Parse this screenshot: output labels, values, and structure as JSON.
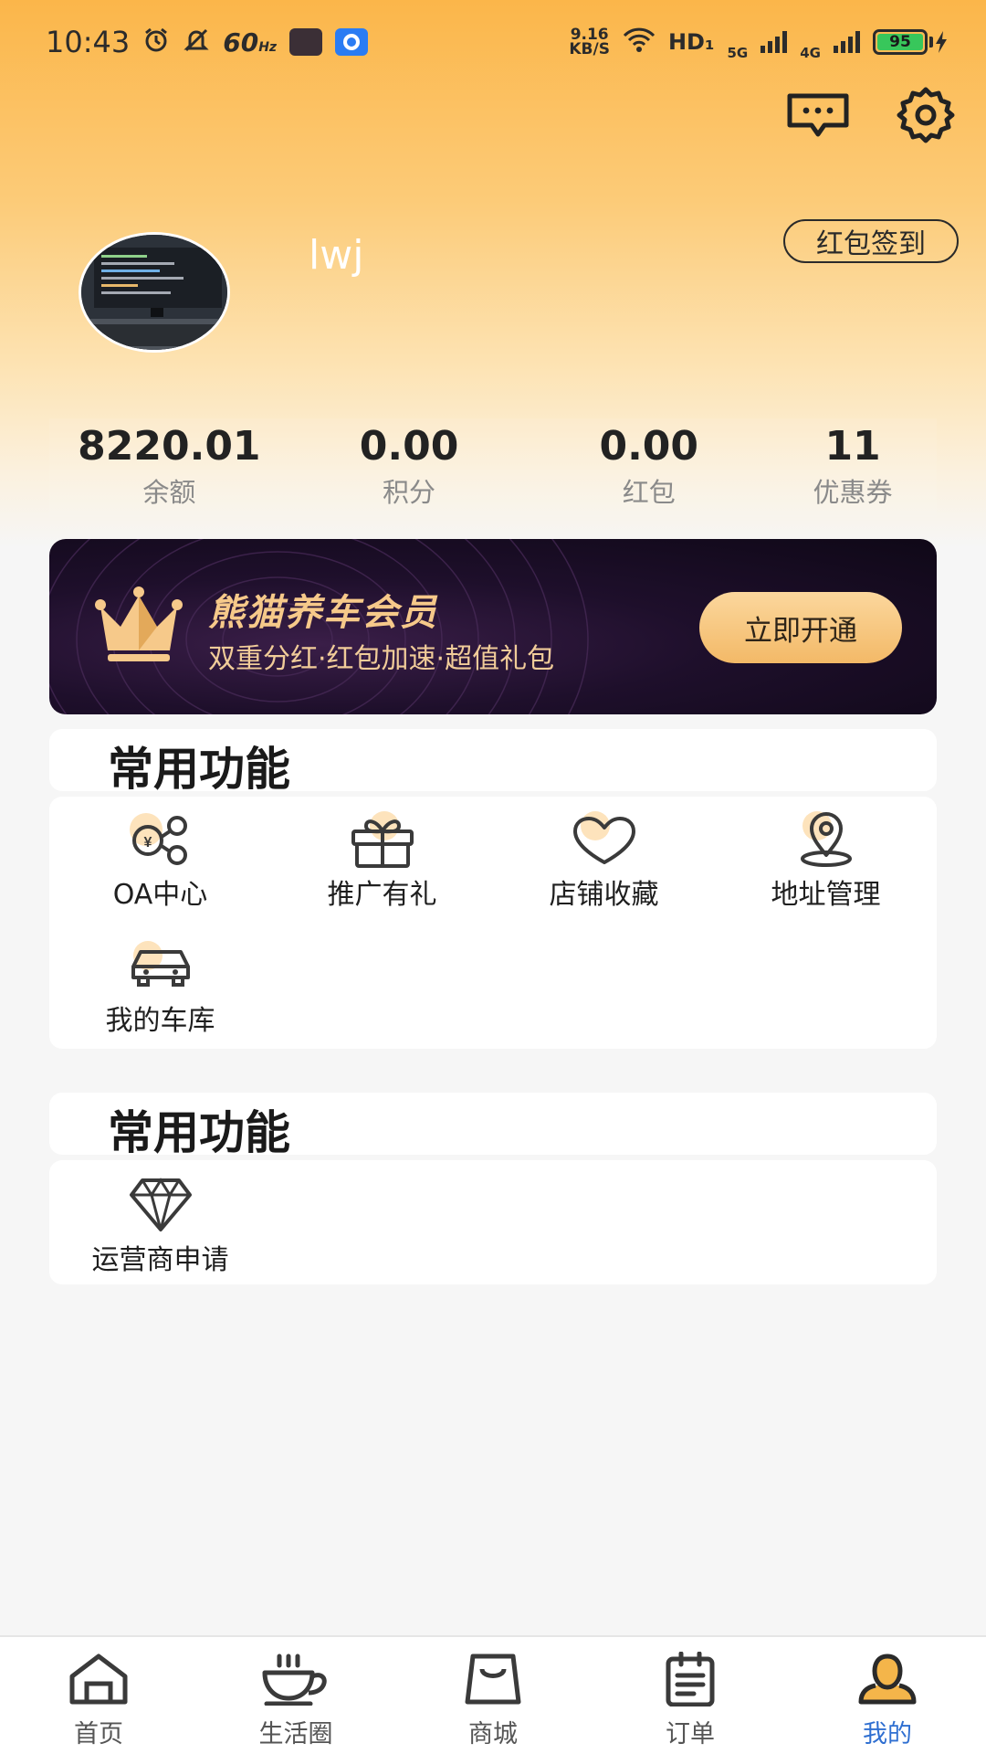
{
  "status_bar": {
    "time": "10:43",
    "refresh_rate": "60",
    "refresh_unit": "Hz",
    "net_speed_value": "9.16",
    "net_speed_unit": "KB/S",
    "network": "HD₁",
    "signal_1": "5G",
    "signal_2": "4G",
    "battery": "95"
  },
  "profile": {
    "username": "lwj",
    "sign_in_button": "红包签到"
  },
  "stats": [
    {
      "value": "8220.01",
      "label": "余额"
    },
    {
      "value": "0.00",
      "label": "积分"
    },
    {
      "value": "0.00",
      "label": "红包"
    },
    {
      "value": "11",
      "label": "优惠券"
    }
  ],
  "vip": {
    "title": "熊猫养车会员",
    "subtitle": "双重分红·红包加速·超值礼包",
    "button": "立即开通"
  },
  "section1": {
    "title": "常用功能",
    "items": [
      {
        "label": "OA中心",
        "icon": "coins-icon"
      },
      {
        "label": "推广有礼",
        "icon": "gift-icon"
      },
      {
        "label": "店铺收藏",
        "icon": "heart-icon"
      },
      {
        "label": "地址管理",
        "icon": "location-pin-icon"
      },
      {
        "label": "我的车库",
        "icon": "car-icon"
      }
    ]
  },
  "section2": {
    "title": "常用功能",
    "items": [
      {
        "label": "运营商申请",
        "icon": "diamond-icon"
      }
    ]
  },
  "tabbar": [
    {
      "label": "首页",
      "icon": "home-icon"
    },
    {
      "label": "生活圈",
      "icon": "coffee-cup-icon"
    },
    {
      "label": "商城",
      "icon": "shopping-bag-icon"
    },
    {
      "label": "订单",
      "icon": "clipboard-icon"
    },
    {
      "label": "我的",
      "icon": "user-icon",
      "active": true
    }
  ],
  "colors": {
    "accent_orange": "#fbb64a",
    "active_tab": "#2f6fd1",
    "vip_gold": "#f6c98a"
  }
}
